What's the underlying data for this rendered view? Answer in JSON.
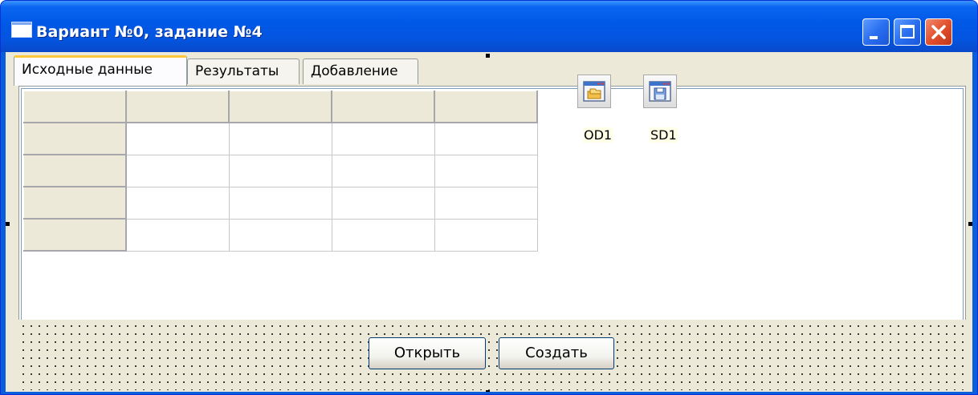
{
  "window": {
    "title": "Вариант №0, задание №4"
  },
  "tabs": [
    {
      "label": "Исходные данные",
      "active": true
    },
    {
      "label": "Результаты",
      "active": false
    },
    {
      "label": "Добавление",
      "active": false
    }
  ],
  "grid": {
    "columns": 5,
    "rows": 5,
    "fixed_rows": 1,
    "fixed_columns": 1
  },
  "components": [
    {
      "label": "OD1",
      "icon": "open-dialog-icon"
    },
    {
      "label": "SD1",
      "icon": "save-dialog-icon"
    }
  ],
  "buttons": {
    "open": "Открыть",
    "create": "Создать"
  }
}
